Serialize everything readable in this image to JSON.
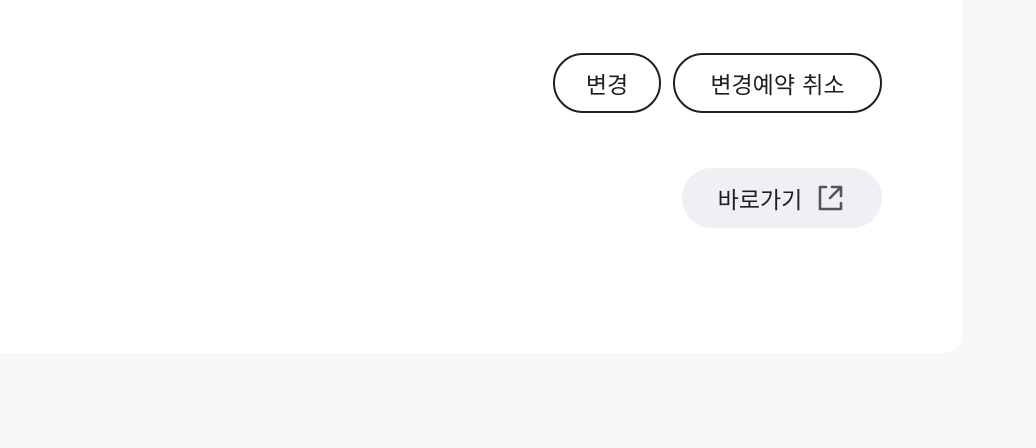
{
  "actions": {
    "change_label": "변경",
    "cancel_reservation_label": "변경예약 취소"
  },
  "link": {
    "shortcut_label": "바로가기",
    "icon": "external-link-icon"
  },
  "colors": {
    "page_background": "#f6f7f9",
    "card_background": "#ffffff",
    "button_border": "#1f1f22",
    "soft_button_background": "#eff0f4",
    "icon_color": "#555555"
  }
}
